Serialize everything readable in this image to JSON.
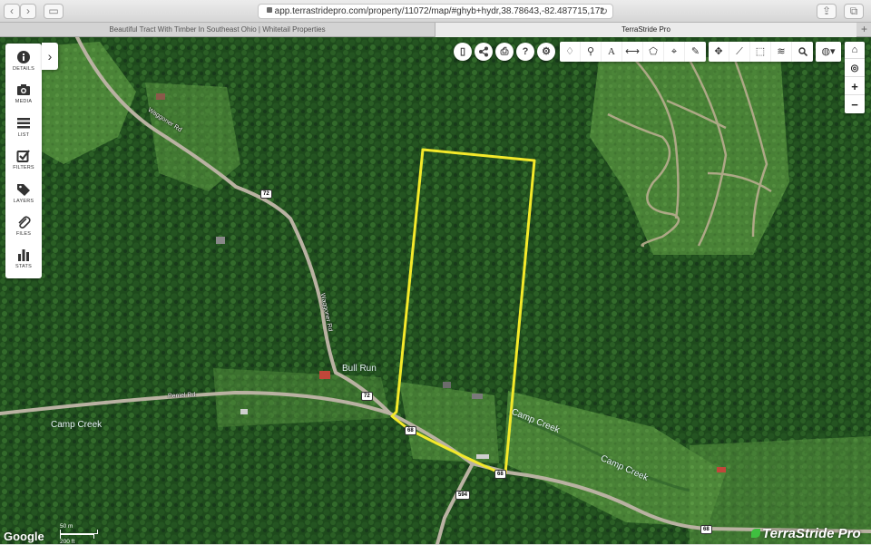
{
  "browser": {
    "url": "app.terrastridepro.com/property/11072/map/#ghyb+hydr,38.78643,-82.487715,17z",
    "tabs": [
      {
        "label": "Beautiful Tract With Timber In Southeast Ohio | Whitetail Properties"
      },
      {
        "label": "TerraStride Pro"
      }
    ]
  },
  "side_panel": {
    "items": [
      {
        "label": "DETAILS",
        "icon": "info-icon"
      },
      {
        "label": "MEDIA",
        "icon": "camera-icon"
      },
      {
        "label": "LIST",
        "icon": "list-icon"
      },
      {
        "label": "FILTERS",
        "icon": "checkbox-icon"
      },
      {
        "label": "LAYERS",
        "icon": "tag-icon"
      },
      {
        "label": "FILES",
        "icon": "paperclip-icon"
      },
      {
        "label": "STATS",
        "icon": "bar-chart-icon"
      }
    ]
  },
  "toolbar": {
    "round_buttons": [
      {
        "icon": "mobile-icon"
      },
      {
        "icon": "share-icon"
      },
      {
        "icon": "print-icon"
      },
      {
        "icon": "help-icon",
        "glyph": "?"
      },
      {
        "icon": "settings-icon"
      }
    ],
    "tools_a": [
      {
        "icon": "lightbulb-icon"
      },
      {
        "icon": "pin-icon"
      },
      {
        "icon": "text-icon",
        "glyph": "A"
      },
      {
        "icon": "measure-line-icon"
      },
      {
        "icon": "polygon-icon"
      },
      {
        "icon": "crosshair-icon"
      },
      {
        "icon": "pencil-icon"
      }
    ],
    "tools_b": [
      {
        "icon": "move-icon"
      },
      {
        "icon": "ruler-icon"
      },
      {
        "icon": "select-area-icon"
      },
      {
        "icon": "layers-icon"
      },
      {
        "icon": "search-icon"
      }
    ],
    "globe": {
      "icon": "globe-icon"
    }
  },
  "map_controls": {
    "home": {
      "icon": "home-icon"
    },
    "locate": {
      "icon": "locate-icon"
    },
    "zoom_in": "+",
    "zoom_out": "−"
  },
  "map": {
    "labels": {
      "bull_run": "Bull Run",
      "camp_creek_1": "Camp Creek",
      "camp_creek_2": "Camp Creek",
      "camp_creek_3": "Camp Creek"
    },
    "roads": {
      "waggoner_1": "Waggoner Rd",
      "waggoner_2": "Waggoner Rd",
      "peniel": "Peniel Rd"
    },
    "shields": [
      "72",
      "72",
      "68",
      "68",
      "594",
      "68"
    ],
    "boundary_color": "#f3e92a",
    "attribution": "Google",
    "scale": {
      "metric": "50 m",
      "imperial": "200 ft"
    }
  },
  "brand": "TerraStride Pro"
}
